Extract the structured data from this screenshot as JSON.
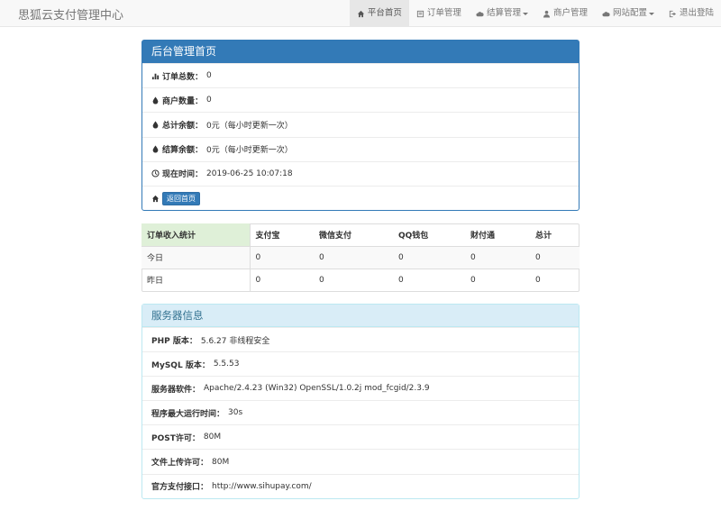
{
  "brand": "思狐云支付管理中心",
  "nav": [
    {
      "label": "平台首页",
      "icon": "home-icon",
      "active": true
    },
    {
      "label": "订单管理",
      "icon": "list-icon"
    },
    {
      "label": "结算管理",
      "icon": "cloud-icon",
      "dropdown": true
    },
    {
      "label": "商户管理",
      "icon": "user-icon"
    },
    {
      "label": "网站配置",
      "icon": "cloud-icon",
      "dropdown": true
    },
    {
      "label": "退出登陆",
      "icon": "logout-icon"
    }
  ],
  "admin_panel": {
    "title": "后台管理首页",
    "rows": [
      {
        "label": "订单总数：",
        "value": "0",
        "icon": "bar-chart-icon"
      },
      {
        "label": "商户数量：",
        "value": "0",
        "icon": "drop-icon"
      },
      {
        "label": "总计余额：",
        "value": "0元（每小时更新一次）",
        "icon": "drop-icon"
      },
      {
        "label": "结算余额：",
        "value": "0元（每小时更新一次）",
        "icon": "drop-icon"
      },
      {
        "label": "现在时间：",
        "value": "2019-06-25 10:07:18",
        "icon": "clock-icon"
      }
    ],
    "home_button": "返回首页"
  },
  "income_table": {
    "headers": [
      "订单收入统计",
      "支付宝",
      "微信支付",
      "QQ钱包",
      "财付通",
      "总计"
    ],
    "rows": [
      [
        "今日",
        "0",
        "0",
        "0",
        "0",
        "0"
      ],
      [
        "昨日",
        "0",
        "0",
        "0",
        "0",
        "0"
      ]
    ]
  },
  "server_panel": {
    "title": "服务器信息",
    "rows": [
      {
        "label": "PHP 版本：",
        "value": "5.6.27 非线程安全"
      },
      {
        "label": "MySQL 版本：",
        "value": "5.5.53"
      },
      {
        "label": "服务器软件：",
        "value": "Apache/2.4.23 (Win32) OpenSSL/1.0.2j mod_fcgid/2.3.9"
      },
      {
        "label": "程序最大运行时间：",
        "value": "30s"
      },
      {
        "label": "POST许可：",
        "value": "80M"
      },
      {
        "label": "文件上传许可：",
        "value": "80M"
      },
      {
        "label": "官方支付接口：",
        "value": "http://www.sihupay.com/"
      }
    ]
  }
}
